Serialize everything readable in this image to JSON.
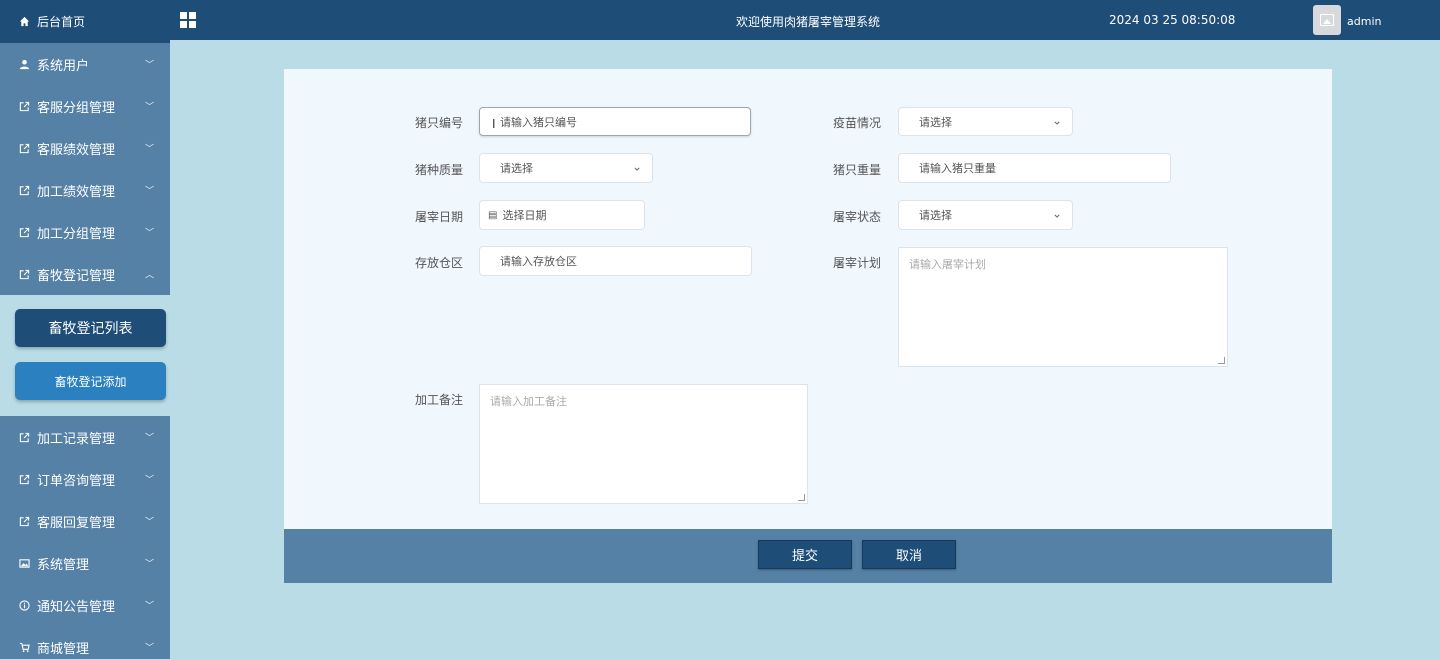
{
  "sidebar": {
    "home": "后台首页",
    "menu": [
      {
        "label": "系统用户",
        "icon": "user-icon"
      },
      {
        "label": "客服分组管理",
        "icon": "external-link-icon"
      },
      {
        "label": "客服绩效管理",
        "icon": "external-link-icon"
      },
      {
        "label": "加工绩效管理",
        "icon": "external-link-icon"
      },
      {
        "label": "加工分组管理",
        "icon": "external-link-icon"
      },
      {
        "label": "畜牧登记管理",
        "icon": "external-link-icon"
      },
      {
        "label": "加工记录管理",
        "icon": "external-link-icon"
      },
      {
        "label": "订单咨询管理",
        "icon": "external-link-icon"
      },
      {
        "label": "客服回复管理",
        "icon": "external-link-icon"
      },
      {
        "label": "系统管理",
        "icon": "image-icon"
      },
      {
        "label": "通知公告管理",
        "icon": "info-icon"
      },
      {
        "label": "商城管理",
        "icon": "cart-icon"
      }
    ],
    "submenu": [
      "畜牧登记列表",
      "畜牧登记添加"
    ]
  },
  "header": {
    "title": "欢迎使用肉猪屠宰管理系统",
    "datetime": "2024 03 25 08:50:08",
    "user": "admin"
  },
  "form": {
    "pig_no": {
      "label": "猪只编号",
      "placeholder": "请输入猪只编号"
    },
    "quarantine": {
      "label": "疫苗情况",
      "placeholder": "请选择"
    },
    "quality": {
      "label": "猪种质量",
      "placeholder": "请选择"
    },
    "weight": {
      "label": "猪只重量",
      "placeholder": "请输入猪只重量"
    },
    "slaughter_date": {
      "label": "屠宰日期",
      "placeholder": "选择日期"
    },
    "slaughter_status": {
      "label": "屠宰状态",
      "placeholder": "请选择"
    },
    "storage": {
      "label": "存放仓区",
      "placeholder": "请输入存放仓区"
    },
    "plan": {
      "label": "屠宰计划",
      "placeholder": "请输入屠宰计划"
    },
    "remark": {
      "label": "加工备注",
      "placeholder": "请输入加工备注"
    }
  },
  "actions": {
    "submit": "提交",
    "cancel": "取消"
  }
}
